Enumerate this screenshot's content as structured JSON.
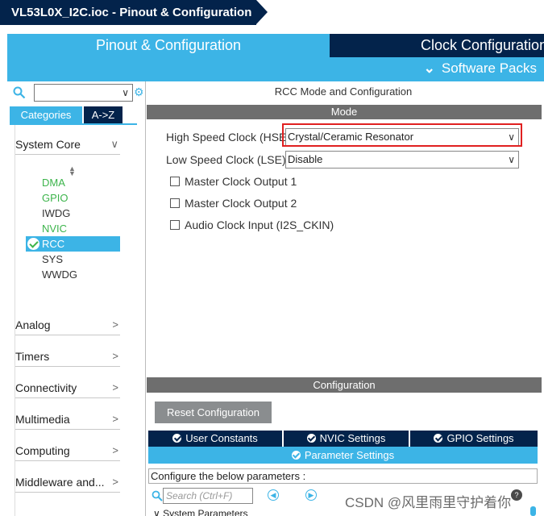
{
  "breadcrumb": {
    "file": "VL53L0X_I2C.ioc",
    "separator": " - ",
    "section": "Pinout & Configuration"
  },
  "tabs": {
    "pinout": "Pinout & Configuration",
    "clock": "Clock Configuration",
    "software_packs": "Software Packs"
  },
  "sidebar": {
    "tab_categories": "Categories",
    "tab_az": "A->Z",
    "system_core": "System Core",
    "items": [
      "DMA",
      "GPIO",
      "IWDG",
      "NVIC",
      "RCC",
      "SYS",
      "WWDG"
    ],
    "groups": [
      "Analog",
      "Timers",
      "Connectivity",
      "Multimedia",
      "Computing",
      "Middleware and..."
    ]
  },
  "panel": {
    "title": "RCC Mode and Configuration",
    "mode_header": "Mode",
    "hse_label": "High Speed Clock (HSE)",
    "hse_value": "Crystal/Ceramic Resonator",
    "lse_label": "Low Speed Clock (LSE)",
    "lse_value": "Disable",
    "checkboxes": [
      "Master Clock Output 1",
      "Master Clock Output 2",
      "Audio Clock Input (I2S_CKIN)"
    ],
    "config_header": "Configuration",
    "reset_button": "Reset Configuration",
    "subtabs": [
      "User Constants",
      "NVIC Settings",
      "GPIO Settings"
    ],
    "param_tab": "Parameter Settings",
    "configure_text": "Configure the below parameters :",
    "search_placeholder": "Search (Ctrl+F)",
    "tree_row": "System Parameters"
  },
  "watermark": "CSDN @风里雨里守护着你",
  "colors": {
    "accent": "#3cb4e6",
    "navy": "#03234b",
    "header_gray": "#6e6e6e",
    "highlight": "#e02020",
    "enabled_green": "#3cb44b"
  }
}
